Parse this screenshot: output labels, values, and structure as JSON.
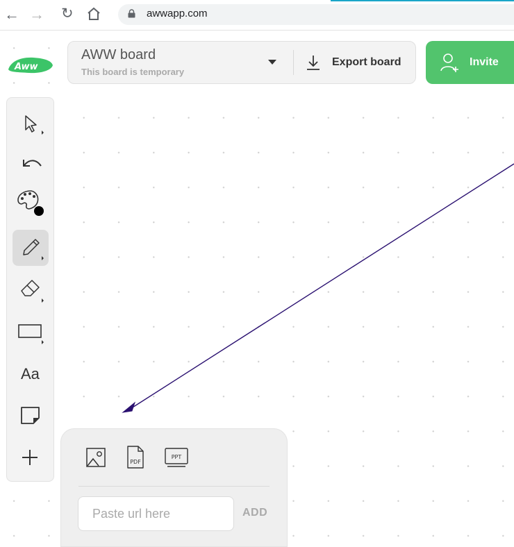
{
  "browser": {
    "url": "awwapp.com"
  },
  "header": {
    "board_title": "AWW board",
    "board_subtitle": "This board is temporary",
    "export_label": "Export board",
    "invite_label": "Invite"
  },
  "toolbar": {
    "items": [
      {
        "name": "select-tool",
        "icon": "cursor-icon"
      },
      {
        "name": "undo-tool",
        "icon": "undo-arrow-icon"
      },
      {
        "name": "color-tool",
        "icon": "palette-icon"
      },
      {
        "name": "pencil-tool",
        "icon": "pencil-icon",
        "active": true
      },
      {
        "name": "eraser-tool",
        "icon": "eraser-icon"
      },
      {
        "name": "shape-tool",
        "icon": "rectangle-icon"
      },
      {
        "name": "text-tool",
        "label": "Aa"
      },
      {
        "name": "sticky-note-tool",
        "icon": "sticky-note-icon"
      },
      {
        "name": "add-tool",
        "icon": "plus-icon"
      }
    ],
    "text_tool_label": "Aa"
  },
  "upload_panel": {
    "image_icon": "image-icon",
    "pdf_label": "PDF",
    "ppt_label": "PPT",
    "url_placeholder": "Paste url here",
    "url_value": "",
    "add_label": "ADD"
  },
  "colors": {
    "invite_green": "#52c46d",
    "logo_green": "#3cc468",
    "arrow": "#2a1070",
    "active_color": "#000000"
  }
}
